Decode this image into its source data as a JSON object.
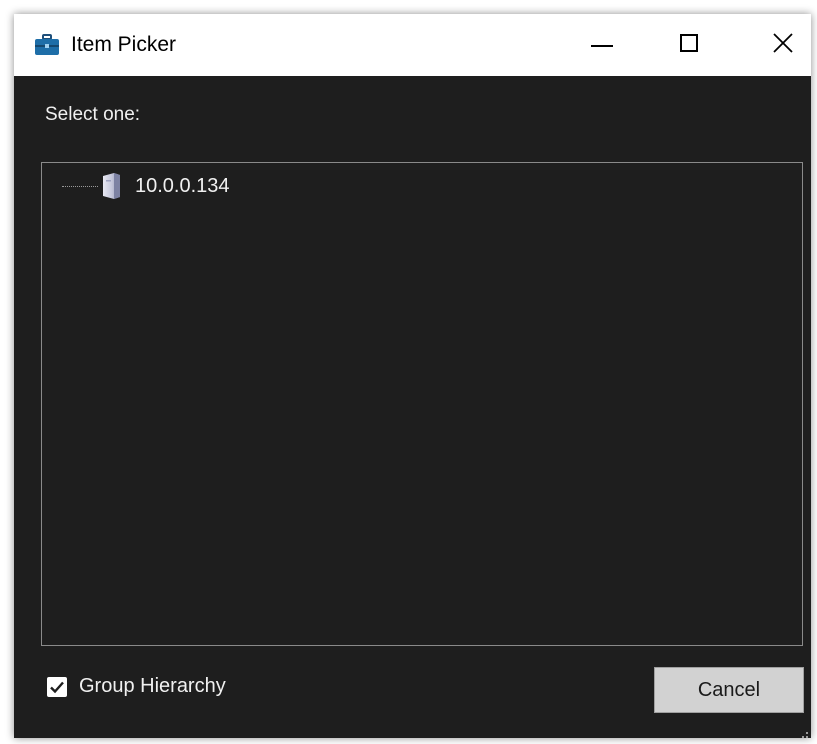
{
  "window": {
    "title": "Item Picker",
    "icons": {
      "app": "toolbox-icon",
      "minimize": "minimize-icon",
      "maximize": "maximize-icon",
      "close": "close-icon"
    }
  },
  "prompt": "Select one:",
  "tree": {
    "items": [
      {
        "label": "10.0.0.134",
        "icon": "server-icon"
      }
    ]
  },
  "options": {
    "group_hierarchy_label": "Group Hierarchy",
    "group_hierarchy_checked": true
  },
  "buttons": {
    "cancel_label": "Cancel"
  },
  "colors": {
    "background": "#1e1e1e",
    "titlebar": "#ffffff",
    "text": "#f0f0f0",
    "border": "#8a8a8a",
    "button": "#d2d2d2",
    "app_icon": "#1e6ea8"
  }
}
